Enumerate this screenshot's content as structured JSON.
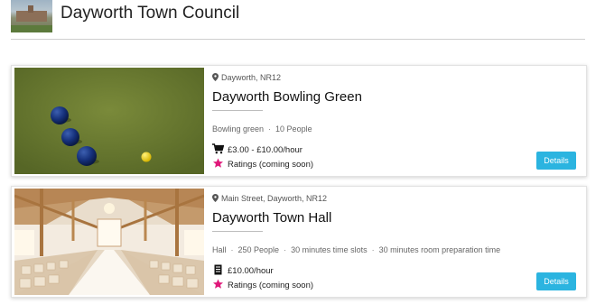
{
  "header": {
    "title": "Dayworth Town Council"
  },
  "venues": [
    {
      "location": "Dayworth, NR12",
      "name": "Dayworth Bowling Green",
      "meta": [
        "Bowling green",
        "10 People"
      ],
      "price": "£3.00 - £10.00/hour",
      "rating": "Ratings (coming soon)",
      "details_label": "Details",
      "price_icon": "cart-icon"
    },
    {
      "location": "Main Street, Dayworth, NR12",
      "name": "Dayworth Town Hall",
      "meta": [
        "Hall",
        "250 People",
        "30 minutes time slots",
        "30 minutes room preparation time"
      ],
      "price": "£10.00/hour",
      "rating": "Ratings (coming soon)",
      "details_label": "Details",
      "price_icon": "receipt-icon"
    }
  ],
  "colors": {
    "accent": "#2bb4e0",
    "star": "#e0187a"
  }
}
